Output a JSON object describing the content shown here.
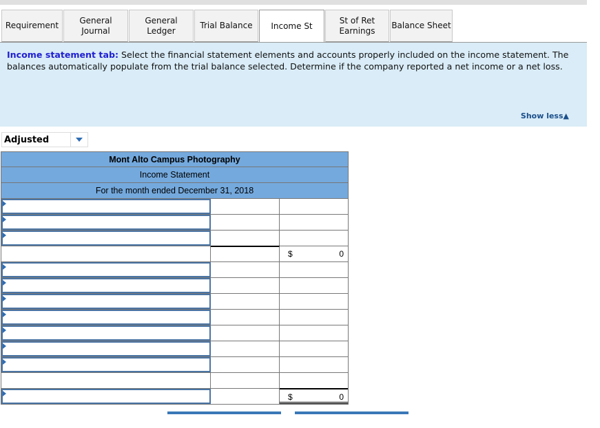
{
  "tabs": [
    {
      "label": "Requirement",
      "active": false
    },
    {
      "label": "General Journal",
      "active": false
    },
    {
      "label": "General Ledger",
      "active": false
    },
    {
      "label": "Trial Balance",
      "active": false
    },
    {
      "label": "Income St",
      "active": true
    },
    {
      "label": "St of Ret Earnings",
      "active": false
    },
    {
      "label": "Balance Sheet",
      "active": false
    }
  ],
  "info": {
    "lead": "Income statement tab:",
    "text": " Select the financial statement elements and accounts properly included on the income statement. The balances automatically populate from the trial balance selected.  Determine if the company reported a net income or a net loss.",
    "toggle_label": "Show less",
    "toggle_icon": "triangle-up-icon"
  },
  "trial_balance_select": {
    "value": "Adjusted",
    "icon": "chevron-down-icon"
  },
  "statement": {
    "company": "Mont Alto Campus Photography",
    "title": "Income Statement",
    "period": "For the month ended December 31, 2018",
    "rows": [
      {
        "type": "input",
        "label": "",
        "col2": "",
        "col3": ""
      },
      {
        "type": "input",
        "label": "",
        "col2": "",
        "col3": ""
      },
      {
        "type": "input",
        "label": "",
        "col2": "",
        "col3": ""
      },
      {
        "type": "subtotal",
        "label": "",
        "col2": "",
        "currency": "$",
        "col3": "0"
      },
      {
        "type": "input",
        "label": "",
        "col2": "",
        "col3": ""
      },
      {
        "type": "input",
        "label": "",
        "col2": "",
        "col3": ""
      },
      {
        "type": "input",
        "label": "",
        "col2": "",
        "col3": ""
      },
      {
        "type": "input",
        "label": "",
        "col2": "",
        "col3": ""
      },
      {
        "type": "input",
        "label": "",
        "col2": "",
        "col3": ""
      },
      {
        "type": "input",
        "label": "",
        "col2": "",
        "col3": ""
      },
      {
        "type": "input",
        "label": "",
        "col2": "",
        "col3": ""
      },
      {
        "type": "plain",
        "label": "",
        "col2": "",
        "col3": ""
      },
      {
        "type": "total",
        "label": "",
        "col2": "",
        "currency": "$",
        "col3": "0"
      }
    ]
  },
  "nav_buttons": [
    {
      "label": ""
    },
    {
      "label": ""
    }
  ]
}
